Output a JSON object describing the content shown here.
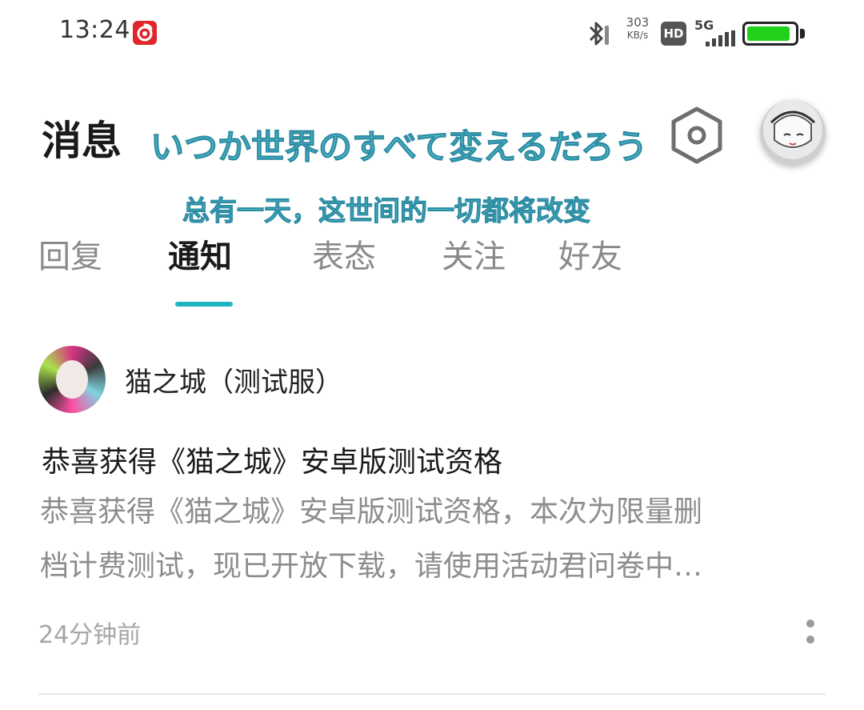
{
  "status_bar": {
    "time": "13:24",
    "net_speed_value": "303",
    "net_speed_unit": "KB/s",
    "hd_label": "HD",
    "network_type": "5G",
    "battery_level": 0.92,
    "battery_color": "#22d11c",
    "app_badge_color": "#e0262b"
  },
  "header": {
    "title": "消息",
    "overlay_jp": "いつか世界のすべて変えるだろう",
    "overlay_cn": "总有一天，这世间的一切都将改变"
  },
  "tabs": [
    {
      "label": "回复",
      "active": false
    },
    {
      "label": "通知",
      "active": true
    },
    {
      "label": "表态",
      "active": false
    },
    {
      "label": "关注",
      "active": false
    },
    {
      "label": "好友",
      "active": false
    }
  ],
  "accent_color": "#1eb4bf",
  "message": {
    "sender": "猫之城（测试服）",
    "title": "恭喜获得《猫之城》安卓版测试资格",
    "body_line1": "恭喜获得《猫之城》安卓版测试资格，本次为限量删",
    "body_line2": "档计费测试，现已开放下载，请使用活动君问卷中…",
    "time": "24分钟前"
  }
}
